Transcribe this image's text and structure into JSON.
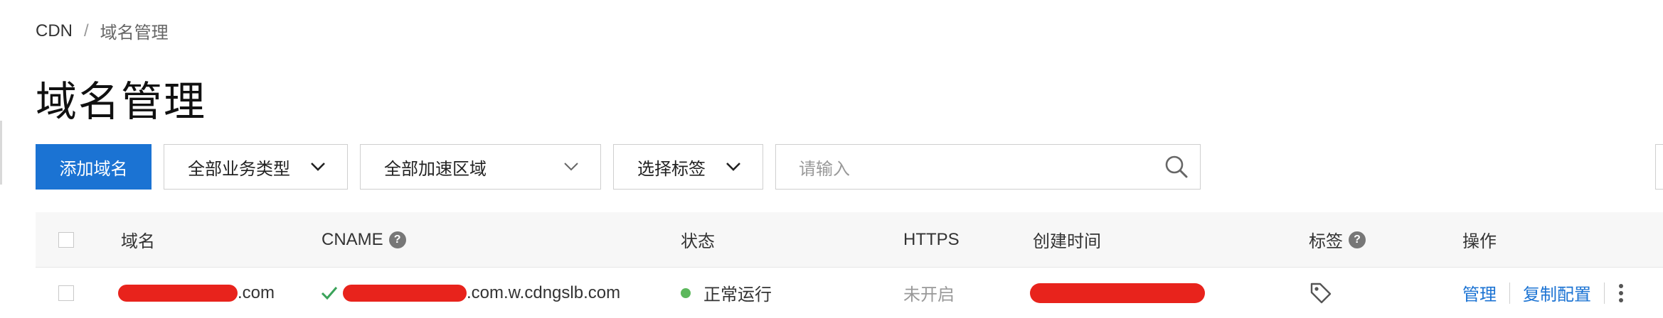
{
  "breadcrumb": {
    "root": "CDN",
    "separator": "/",
    "current": "域名管理"
  },
  "page_title": "域名管理",
  "toolbar": {
    "add_domain_label": "添加域名",
    "business_type_select": "全部业务类型",
    "region_select": "全部加速区域",
    "tag_select": "选择标签",
    "search_placeholder": "请输入"
  },
  "table": {
    "columns": [
      "域名",
      "CNAME",
      "状态",
      "HTTPS",
      "创建时间",
      "标签",
      "操作"
    ],
    "rows": [
      {
        "domain_suffix": ".com",
        "cname_suffix": ".com.w.cdngslb.com",
        "status": "正常运行",
        "https": "未开启",
        "actions": {
          "manage": "管理",
          "copy": "复制配置"
        }
      }
    ]
  },
  "colors": {
    "primary": "#1b73d3",
    "status_ok": "#5cb85c",
    "redaction": "#e8231c"
  },
  "icons": [
    "chevron-down-icon",
    "search-icon",
    "help-icon",
    "check-icon",
    "tag-icon",
    "more-vertical-icon"
  ]
}
